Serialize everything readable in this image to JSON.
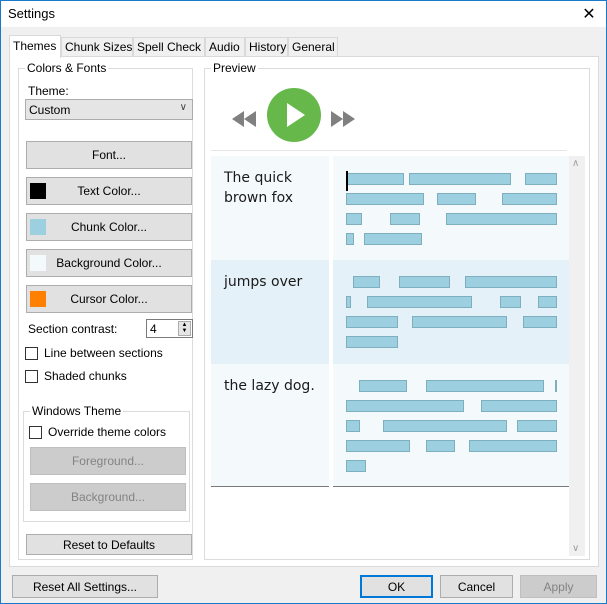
{
  "window": {
    "title": "Settings",
    "close_icon": "close-icon"
  },
  "tabs": [
    {
      "label": "Themes",
      "active": true
    },
    {
      "label": "Chunk Sizes",
      "active": false
    },
    {
      "label": "Spell Check",
      "active": false
    },
    {
      "label": "Audio",
      "active": false
    },
    {
      "label": "History",
      "active": false
    },
    {
      "label": "General",
      "active": false
    }
  ],
  "colors_fonts": {
    "group_label": "Colors & Fonts",
    "theme_label": "Theme:",
    "theme_value": "Custom",
    "font_button": "Font...",
    "text_color_button": "Text Color...",
    "text_color": "#000000",
    "chunk_color_button": "Chunk Color...",
    "chunk_color": "#9ccfe0",
    "background_color_button": "Background Color...",
    "background_color": "#f4f9fc",
    "cursor_color_button": "Cursor Color...",
    "cursor_color": "#ff8000",
    "section_contrast_label": "Section contrast:",
    "section_contrast_value": "4",
    "line_between_sections_label": "Line between sections",
    "line_between_sections_checked": false,
    "shaded_chunks_label": "Shaded chunks",
    "shaded_chunks_checked": false
  },
  "windows_theme": {
    "group_label": "Windows Theme",
    "override_label": "Override theme colors",
    "override_checked": false,
    "foreground_button": "Foreground...",
    "background_button": "Background..."
  },
  "reset_defaults_button": "Reset to Defaults",
  "preview": {
    "group_label": "Preview",
    "play_color": "#66b84b",
    "sections": [
      {
        "text_lines": [
          "The quick",
          "brown fox"
        ],
        "shade": "#f4f9fc"
      },
      {
        "text_lines": [
          "jumps over"
        ],
        "shade": "#e5f1f8"
      },
      {
        "text_lines": [
          "the lazy dog."
        ],
        "shade": "#f4f9fc"
      }
    ]
  },
  "footer": {
    "reset_all_button": "Reset All Settings...",
    "ok_button": "OK",
    "cancel_button": "Cancel",
    "apply_button": "Apply"
  }
}
